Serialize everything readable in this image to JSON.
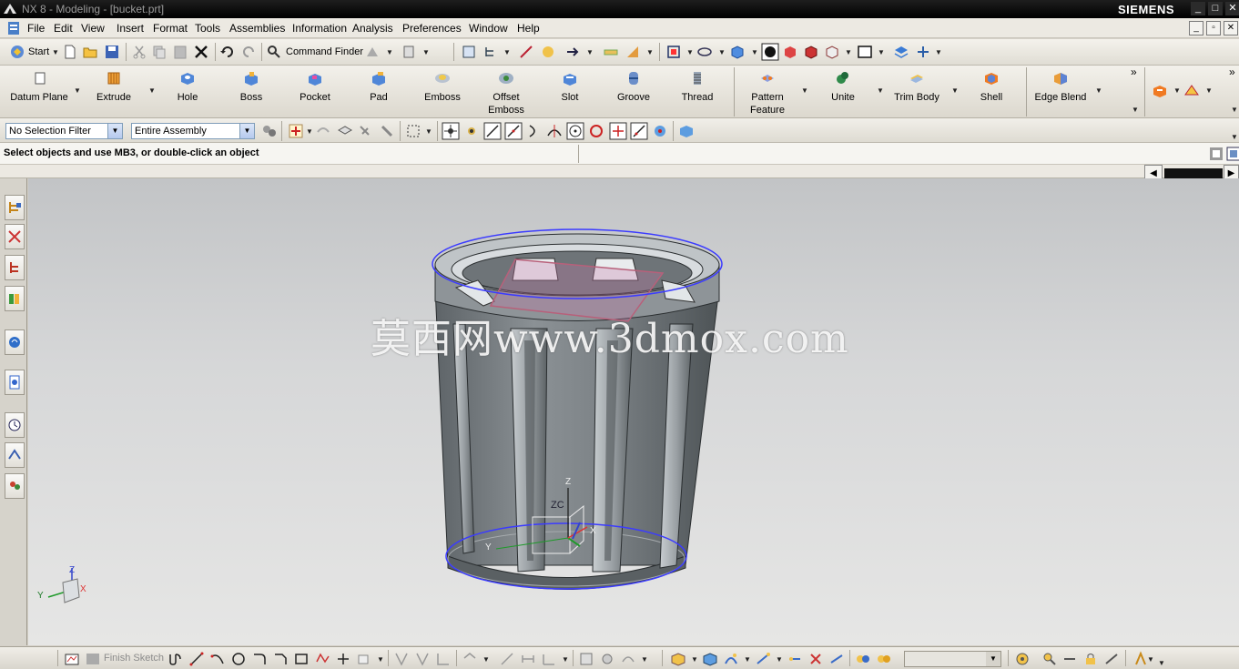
{
  "window": {
    "title": "NX 8 - Modeling - [bucket.prt]",
    "brand": "SIEMENS",
    "controls": [
      "_",
      "□",
      "✕"
    ]
  },
  "menu": {
    "items": [
      "File",
      "Edit",
      "View",
      "Insert",
      "Format",
      "Tools",
      "Assemblies",
      "Information",
      "Analysis",
      "Preferences",
      "Window",
      "Help"
    ]
  },
  "standard_toolbar": {
    "start_label": "Start",
    "command_finder_label": "Command Finder"
  },
  "feature_toolbar": {
    "items": [
      {
        "label": "Datum Plane",
        "icon": "datum-plane-icon"
      },
      {
        "label": "Extrude",
        "icon": "extrude-icon"
      },
      {
        "label": "Hole",
        "icon": "hole-icon"
      },
      {
        "label": "Boss",
        "icon": "boss-icon"
      },
      {
        "label": "Pocket",
        "icon": "pocket-icon"
      },
      {
        "label": "Pad",
        "icon": "pad-icon"
      },
      {
        "label": "Emboss",
        "icon": "emboss-icon"
      },
      {
        "label": "Offset Emboss",
        "icon": "offset-emboss-icon"
      },
      {
        "label": "Slot",
        "icon": "slot-icon"
      },
      {
        "label": "Groove",
        "icon": "groove-icon"
      },
      {
        "label": "Thread",
        "icon": "thread-icon"
      },
      {
        "label": "Pattern Feature",
        "icon": "pattern-feature-icon"
      },
      {
        "label": "Unite",
        "icon": "unite-icon"
      },
      {
        "label": "Trim Body",
        "icon": "trim-body-icon"
      },
      {
        "label": "Shell",
        "icon": "shell-icon"
      },
      {
        "label": "Edge Blend",
        "icon": "edge-blend-icon"
      }
    ]
  },
  "selection_bar": {
    "filter_value": "No Selection Filter",
    "scope_value": "Entire Assembly"
  },
  "cue_line": {
    "text": "Select objects and use MB3, or double-click an object"
  },
  "graphics": {
    "watermark": "莫西网www.3dmox.com",
    "wcs_labels": {
      "z": "ZC",
      "x": "X",
      "y": "Y",
      "z_small": "Z"
    },
    "view_triad": {
      "z": "Z",
      "y": "Y",
      "x": "X"
    }
  },
  "bottom_toolbar": {
    "finish_sketch_label": "Finish Sketch"
  },
  "colors": {
    "model_body": "#7d8387",
    "selection_blue": "#3b3bff",
    "datum_plane": "#b8607a",
    "title_bg": "#000000",
    "toolbar_bg": "#ece9e2"
  }
}
